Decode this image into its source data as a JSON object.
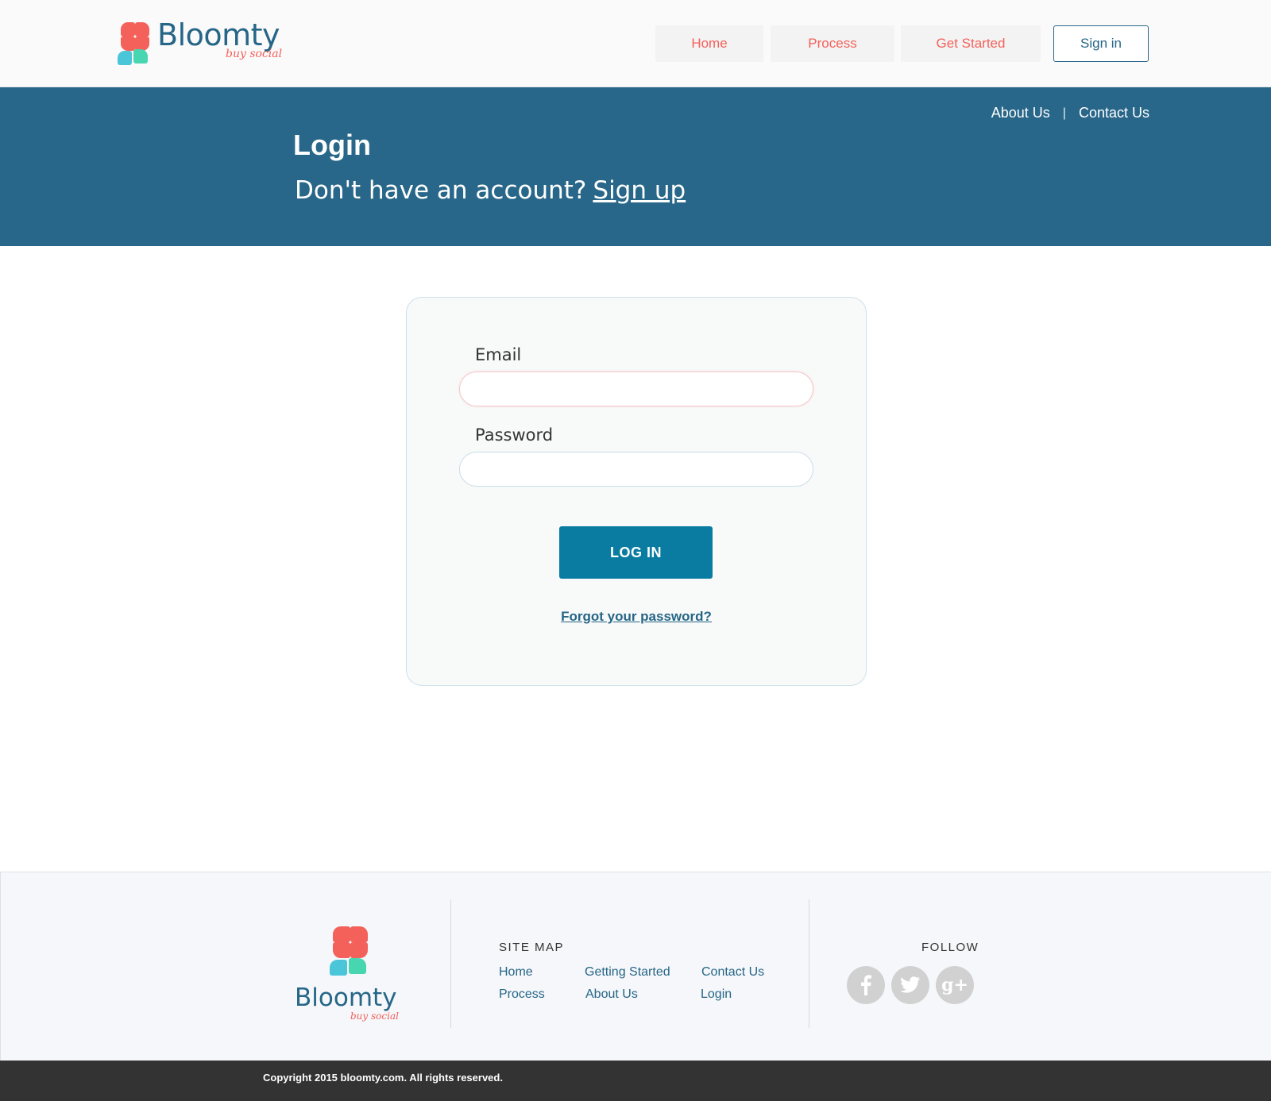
{
  "brand": {
    "name": "Bloomty",
    "tagline": "buy social"
  },
  "header": {
    "nav": [
      "Home",
      "Process",
      "Get Started"
    ],
    "sign_in": "Sign in"
  },
  "banner": {
    "links": [
      "About Us",
      "Contact Us"
    ],
    "separator": "|",
    "title": "Login",
    "prompt": "Don't have an account?",
    "signup": "Sign up"
  },
  "form": {
    "email_label": "Email",
    "email_value": "",
    "password_label": "Password",
    "password_value": "",
    "submit": "LOG IN",
    "forgot": "Forgot your password?"
  },
  "footer": {
    "sitemap_title": "SITE MAP",
    "sitemap_links": [
      "Home",
      "Process",
      "Getting Started",
      "About Us",
      "Contact Us",
      "Login"
    ],
    "follow_title": "FOLLOW",
    "social_icons": [
      "facebook-icon",
      "twitter-icon",
      "google-plus-icon"
    ],
    "social_glyphs": [
      "f",
      "t",
      "g+"
    ],
    "copyright": "Copyright 2015 bloomty.com. All rights reserved."
  },
  "colors": {
    "primary": "#286789",
    "accent": "#f4605a",
    "button": "#0a7ca1",
    "footer_bar": "#333333"
  }
}
